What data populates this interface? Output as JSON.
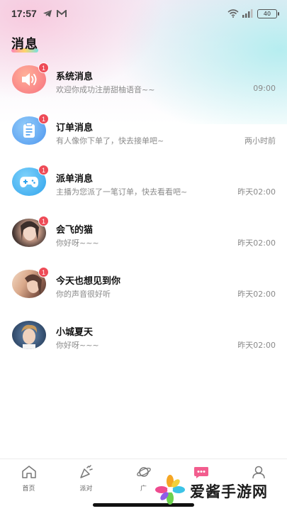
{
  "status_bar": {
    "time": "17:57",
    "battery": "40",
    "left_icons": [
      "telegram-icon",
      "gmail-icon"
    ],
    "right_icons": [
      "wifi-icon",
      "signal-icon",
      "battery-icon"
    ]
  },
  "page": {
    "title": "消息"
  },
  "messages": [
    {
      "name": "系统消息",
      "preview": "欢迎你成功注册甜柚语音~~",
      "time": "09:00",
      "badge": "1",
      "avatar": "speaker-icon"
    },
    {
      "name": "订单消息",
      "preview": "有人像你下单了，快去接单吧~",
      "time": "两小时前",
      "badge": "1",
      "avatar": "order-icon"
    },
    {
      "name": "派单消息",
      "preview": "主播为您派了一笔订单，快去看看吧~",
      "time": "昨天02:00",
      "badge": "1",
      "avatar": "gamepad-icon"
    },
    {
      "name": "会飞的猫",
      "preview": "你好呀~~~",
      "time": "昨天02:00",
      "badge": "1",
      "avatar": "user-avatar"
    },
    {
      "name": "今天也想见到你",
      "preview": "你的声音很好听",
      "time": "昨天02:00",
      "badge": "1",
      "avatar": "user-avatar"
    },
    {
      "name": "小城夏天",
      "preview": "你好呀~~~",
      "time": "昨天02:00",
      "badge": "",
      "avatar": "user-avatar"
    }
  ],
  "tabbar": {
    "items": [
      {
        "label": "首页",
        "icon": "home-icon"
      },
      {
        "label": "派对",
        "icon": "party-icon"
      },
      {
        "label": "广",
        "icon": "planet-icon"
      },
      {
        "label": "",
        "icon": "message-icon"
      },
      {
        "label": "",
        "icon": "profile-icon"
      }
    ]
  },
  "watermark": {
    "text": "爱酱手游网"
  },
  "colors": {
    "badge": "#ee4b57",
    "system_avatar": "#f77f86",
    "order_avatar": "#5aa7f2",
    "dispatch_avatar": "#3fb1ee",
    "active_tab": "#f25d8e"
  }
}
